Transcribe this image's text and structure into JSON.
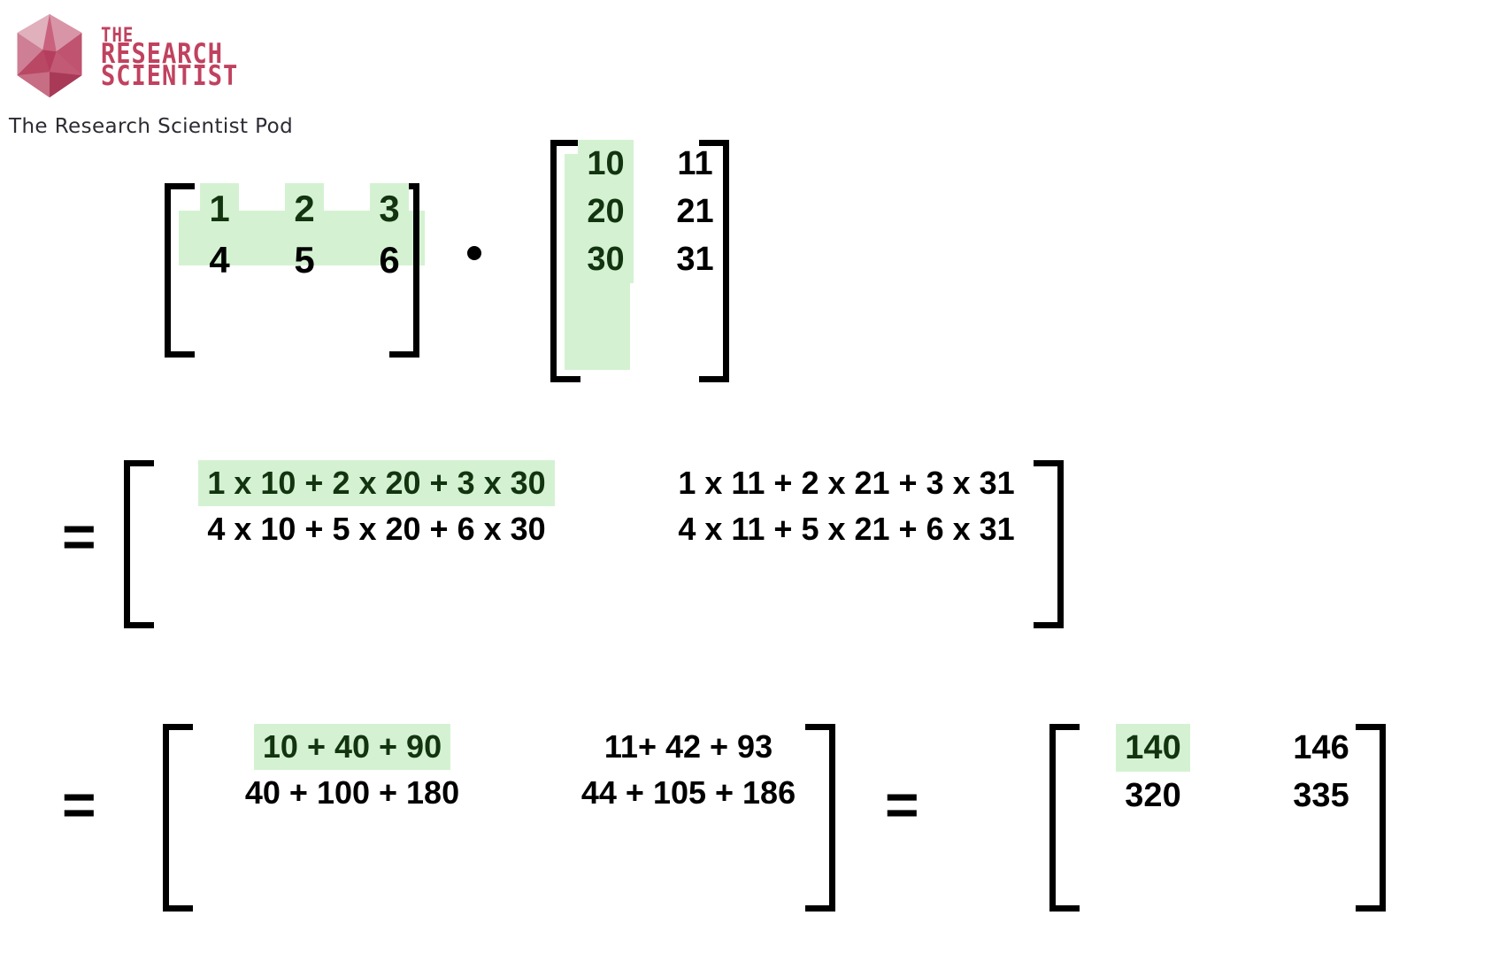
{
  "brand": {
    "logo_icon": "polygon-icon",
    "wordmark_line1": "THE",
    "wordmark_line2": "RESEARCH",
    "wordmark_line3": "SCIENTIST",
    "tagline": "The Research Scientist Pod",
    "brand_color": "#c0425f"
  },
  "colors": {
    "highlight_bg": "#d4f2d2",
    "highlight_text": "#12340f",
    "text": "#000000"
  },
  "operators": {
    "dot": "·",
    "equals_1": "=",
    "equals_2": "=",
    "equals_3": "="
  },
  "matrix_a": {
    "label": "matrix-a",
    "rows": 2,
    "cols": 3,
    "highlight": "row-0",
    "cells": [
      [
        "1",
        "2",
        "3"
      ],
      [
        "4",
        "5",
        "6"
      ]
    ]
  },
  "matrix_b": {
    "label": "matrix-b",
    "rows": 3,
    "cols": 2,
    "highlight": "col-0",
    "cells": [
      [
        "10",
        "11"
      ],
      [
        "20",
        "21"
      ],
      [
        "30",
        "31"
      ]
    ]
  },
  "matrix_c": {
    "label": "expanded-products",
    "rows": 2,
    "cols": 2,
    "highlight": "cell-0-0",
    "cells": [
      [
        "1 x 10  + 2 x 20 + 3 x 30",
        "1 x 11  + 2 x 21 + 3 x 31"
      ],
      [
        "4 x 10 + 5 x 20 + 6 x 30",
        "4 x 11 + 5 x 21 + 6 x 31"
      ]
    ]
  },
  "matrix_d": {
    "label": "partial-sums",
    "rows": 2,
    "cols": 2,
    "highlight": "cell-0-0",
    "cells": [
      [
        "10 + 40 + 90",
        "11+ 42 + 93"
      ],
      [
        "40 + 100 + 180",
        "44 + 105 + 186"
      ]
    ]
  },
  "matrix_e": {
    "label": "result",
    "rows": 2,
    "cols": 2,
    "highlight": "cell-0-0",
    "cells": [
      [
        "140",
        "146"
      ],
      [
        "320",
        "335"
      ]
    ]
  }
}
